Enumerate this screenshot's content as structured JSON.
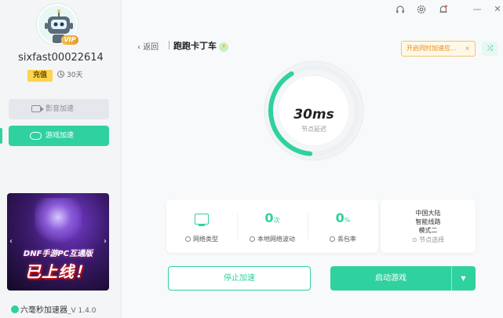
{
  "user": {
    "name": "sixfast00022614",
    "vip_label": "VIP",
    "recharge_label": "充值",
    "days_left": "30天"
  },
  "sidebar": {
    "items": [
      {
        "label": "影音加速",
        "active": false
      },
      {
        "label": "游戏加速",
        "active": true
      }
    ]
  },
  "banner": {
    "line1": "DNF手游PC互通版",
    "line2": "已上线！",
    "prev_arrow": "‹",
    "next_arrow": "›"
  },
  "footer": {
    "app_name": "六毫秒加速器",
    "version": "_V 1.4.0"
  },
  "window": {
    "icons": [
      "headset-icon",
      "gear-icon",
      "bell-icon",
      "minimize-icon",
      "close-icon"
    ],
    "minimize_glyph": "—",
    "close_glyph": "✕"
  },
  "header": {
    "back_label": "返回",
    "game_title": "跑跑卡丁车",
    "notice_text": "开启同时加速应...",
    "notice_close": "×"
  },
  "gauge": {
    "latency": "30ms",
    "label": "节点延迟",
    "progress": 0.4
  },
  "stats": {
    "network_type_label": "网络类型",
    "fluctuation_value": "0",
    "fluctuation_unit": "次",
    "fluctuation_label": "本地网络波动",
    "packet_loss_value": "0",
    "packet_loss_unit": "%",
    "packet_loss_label": "丢包率"
  },
  "node": {
    "region": "中国大陆",
    "route": "智能线路",
    "mode": "模式二",
    "label": "节点选择"
  },
  "actions": {
    "stop_label": "停止加速",
    "start_label": "启动游戏",
    "dropdown_glyph": "▼"
  },
  "colors": {
    "accent": "#2fd19f",
    "notice": "#e3901b",
    "recharge": "#ffd34c"
  }
}
